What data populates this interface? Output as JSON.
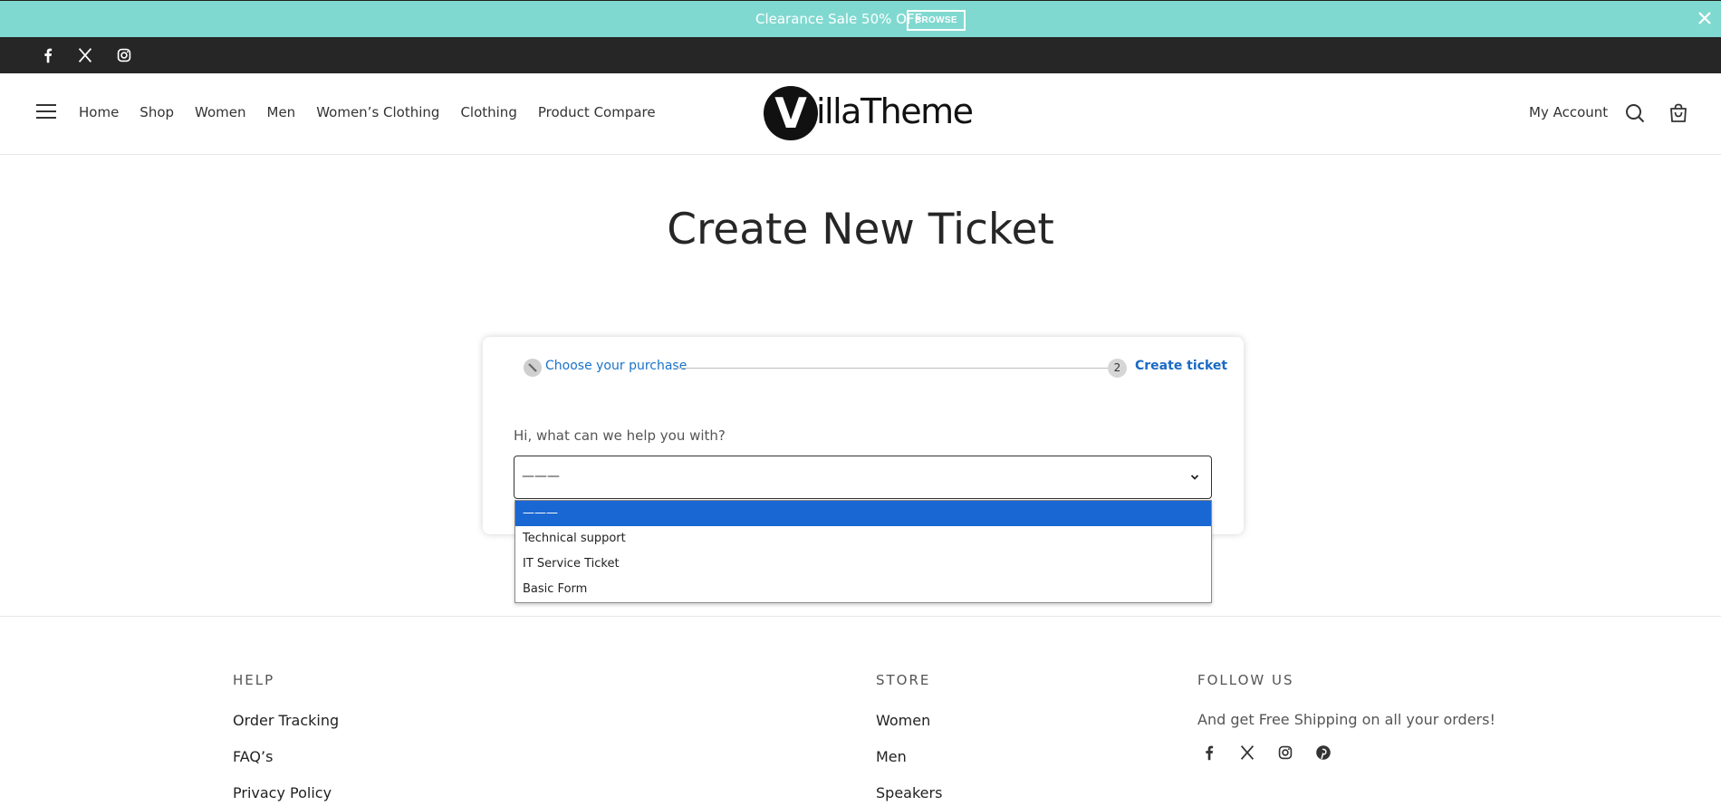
{
  "announcement": {
    "text": "Clearance Sale 50% OFF",
    "button_label": "BROWSE"
  },
  "social_top": [
    "facebook-icon",
    "x-twitter-icon",
    "instagram-icon"
  ],
  "nav": {
    "items": [
      "Home",
      "Shop",
      "Women",
      "Men",
      "Women’s Clothing",
      "Clothing",
      "Product Compare"
    ],
    "my_account": "My Account"
  },
  "logo": {
    "letter": "V",
    "text": "illaTheme"
  },
  "page": {
    "title": "Create New Ticket"
  },
  "steps": {
    "step1_label": "Choose your purchase",
    "step2_number": "2",
    "step2_label": "Create ticket"
  },
  "form": {
    "question": "Hi, what can we help you with?",
    "selected_value": "———",
    "options": [
      "———",
      "Technical support",
      "IT Service Ticket",
      "Basic Form"
    ]
  },
  "footer": {
    "help_heading": "HELP",
    "help_links": [
      "Order Tracking",
      "FAQ’s",
      "Privacy Policy"
    ],
    "store_heading": "STORE",
    "store_links": [
      "Women",
      "Men",
      "Speakers"
    ],
    "follow_heading": "FOLLOW US",
    "follow_text": "And get Free Shipping on all your orders!",
    "follow_icons": [
      "facebook-icon",
      "x-twitter-icon",
      "instagram-icon",
      "pinterest-icon"
    ]
  },
  "colors": {
    "announcement_bg": "#80d9d0",
    "social_bar_bg": "#262626",
    "accent_blue": "#1a73c9",
    "selected_option_bg": "#1967d2"
  }
}
